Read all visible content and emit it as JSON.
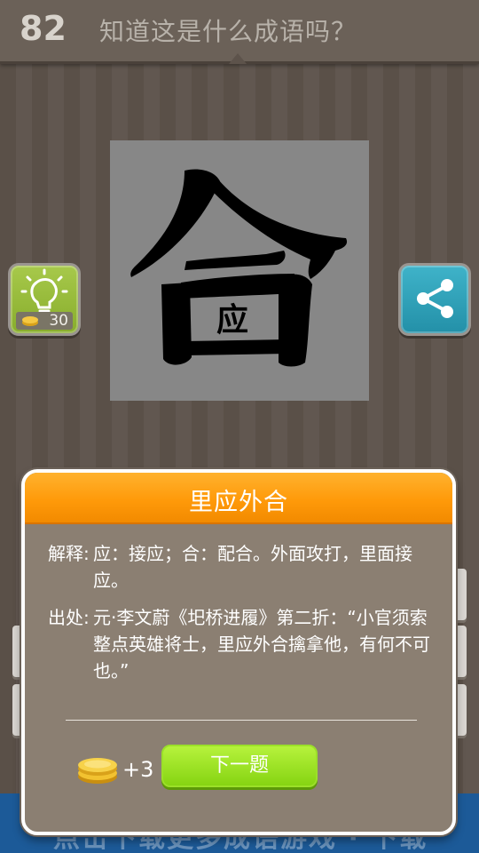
{
  "header": {
    "level": "82",
    "question": "知道这是什么成语吗？"
  },
  "puzzle": {
    "big_char": "合",
    "inner_char": "应"
  },
  "hint": {
    "cost": "30",
    "icon": "lightbulb-icon"
  },
  "share": {
    "icon": "share-icon"
  },
  "dialog": {
    "title": "里应外合",
    "explanation_label": "解释:",
    "explanation_text": "应：接应；合：配合。外面攻打，里面接应。",
    "source_label": "出处:",
    "source_text": "元·李文蔚《圯桥进履》第二折：“小官须索整点英雄将士，里应外合擒拿他，有何不可也。”",
    "reward": "+3",
    "next_button": "下一题"
  },
  "footer": {
    "banner_text": "点击下载更多成语游戏 · 下载"
  },
  "colors": {
    "header_orange": "#ff9a0a",
    "next_button_green": "#86d412",
    "hint_green": "#88ad2c",
    "share_teal": "#2390a8",
    "footer_blue": "#1c5a98"
  }
}
